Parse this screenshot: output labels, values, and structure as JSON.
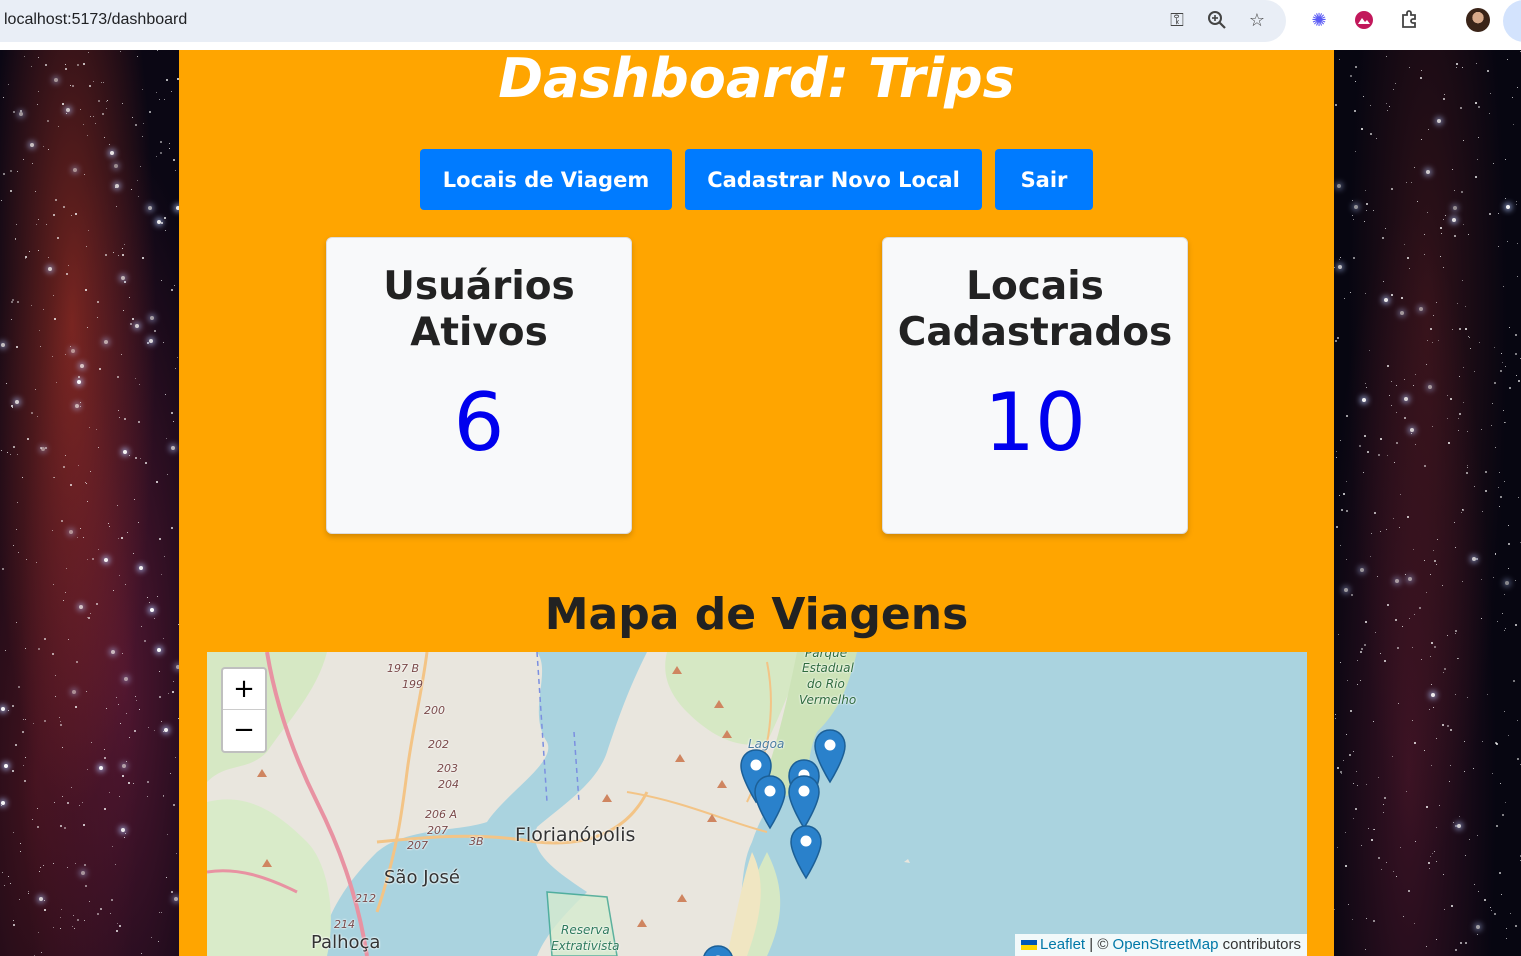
{
  "browser": {
    "url": "localhost:5173/dashboard"
  },
  "page": {
    "title": "Dashboard: Trips"
  },
  "nav": {
    "locais_label": "Locais de Viagem",
    "cadastrar_label": "Cadastrar Novo Local",
    "sair_label": "Sair"
  },
  "stats": {
    "usuarios": {
      "title_line1": "Usuários",
      "title_line2": "Ativos",
      "value": "6"
    },
    "locais": {
      "title_line1": "Locais",
      "title_line2": "Cadastrados",
      "value": "10"
    }
  },
  "map_section": {
    "title": "Mapa de Viagens",
    "zoom_in": "+",
    "zoom_out": "−",
    "labels": {
      "florianopolis": "Florianópolis",
      "sao_jose": "São José",
      "palhoca": "Palhoça",
      "parque": "Parque",
      "estadual": "Estadual",
      "do_rio": "do Rio",
      "vermelho": "Vermelho",
      "lagoa": "Lagoa",
      "reserva": "Reserva",
      "extrativista": "Extrativista",
      "road_197b": "197 B",
      "road_199": "199",
      "road_200": "200",
      "road_202": "202",
      "road_203": "203",
      "road_204": "204",
      "road_206a": "206 A",
      "road_207a": "207",
      "road_207b": "207",
      "road_3b": "3B",
      "road_212": "212",
      "road_214": "214"
    },
    "attribution": {
      "leaflet": "Leaflet",
      "separator": " | © ",
      "osm": "OpenStreetMap",
      "suffix": " contributors"
    },
    "marker_color": "#2a81cb"
  }
}
